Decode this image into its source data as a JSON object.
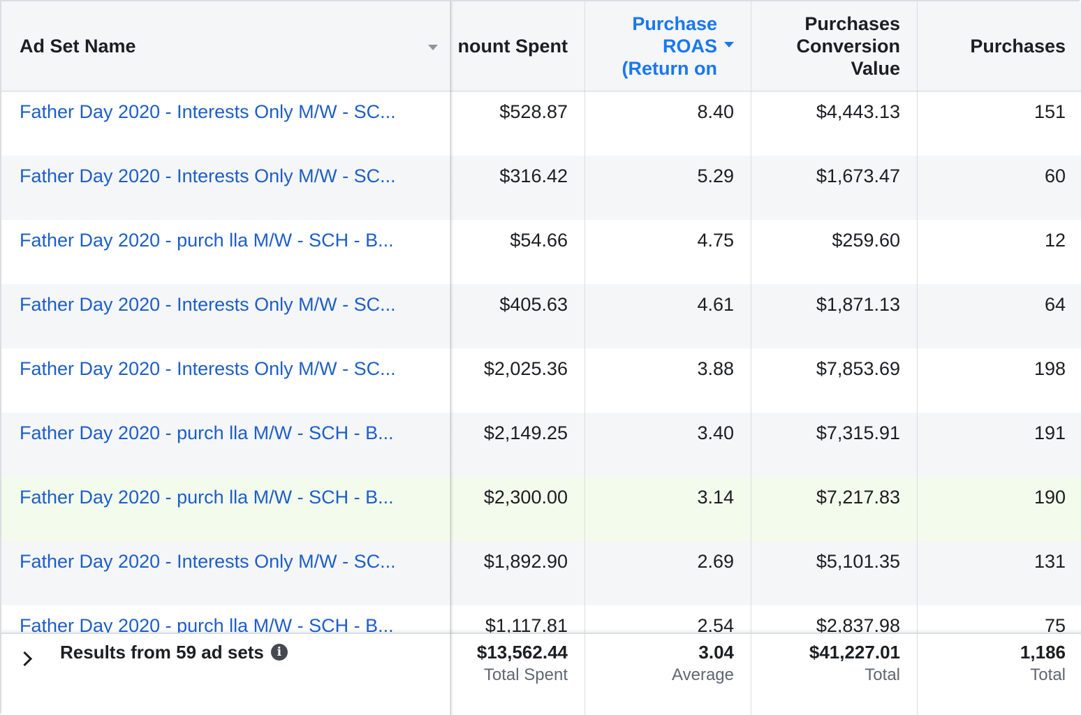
{
  "columns": {
    "ad_set_name": "Ad Set Name",
    "amount_spent": "nount Spent",
    "purchase_roas": "Purchase\nROAS\n(Return on",
    "purchases_conversion_value": "Purchases\nConversion\nValue",
    "purchases": "Purchases"
  },
  "rows": [
    {
      "name": "Father Day 2020 - Interests Only M/W - SC...",
      "spent": "$528.87",
      "roas": "8.40",
      "value": "$4,443.13",
      "purchases": "151"
    },
    {
      "name": "Father Day 2020 - Interests Only M/W - SC...",
      "spent": "$316.42",
      "roas": "5.29",
      "value": "$1,673.47",
      "purchases": "60"
    },
    {
      "name": "Father Day 2020 - purch lla M/W - SCH - B...",
      "spent": "$54.66",
      "roas": "4.75",
      "value": "$259.60",
      "purchases": "12"
    },
    {
      "name": "Father Day 2020 - Interests Only M/W - SC...",
      "spent": "$405.63",
      "roas": "4.61",
      "value": "$1,871.13",
      "purchases": "64"
    },
    {
      "name": "Father Day 2020 - Interests Only M/W - SC...",
      "spent": "$2,025.36",
      "roas": "3.88",
      "value": "$7,853.69",
      "purchases": "198"
    },
    {
      "name": "Father Day 2020 - purch lla M/W - SCH - B...",
      "spent": "$2,149.25",
      "roas": "3.40",
      "value": "$7,315.91",
      "purchases": "191"
    },
    {
      "name": "Father Day 2020 - purch lla M/W - SCH - B...",
      "spent": "$2,300.00",
      "roas": "3.14",
      "value": "$7,217.83",
      "purchases": "190"
    },
    {
      "name": "Father Day 2020 - Interests Only M/W - SC...",
      "spent": "$1,892.90",
      "roas": "2.69",
      "value": "$5,101.35",
      "purchases": "131"
    },
    {
      "name": "Father Day 2020 - purch lla M/W - SCH - B...",
      "spent": "$1,117.81",
      "roas": "2.54",
      "value": "$2,837.98",
      "purchases": "75"
    }
  ],
  "footer": {
    "results_label": "Results from 59 ad sets",
    "info_glyph": "i",
    "spent_total": "$13,562.44",
    "spent_label": "Total Spent",
    "roas_avg": "3.04",
    "roas_label": "Average",
    "value_total": "$41,227.01",
    "value_label": "Total",
    "purchases_total": "1,186",
    "purchases_label": "Total"
  },
  "colors": {
    "link": "#1d5ec8",
    "sorted_header": "#1877f2",
    "alt_row": "#f5f6f7",
    "highlight_row": "#f3fbec"
  }
}
